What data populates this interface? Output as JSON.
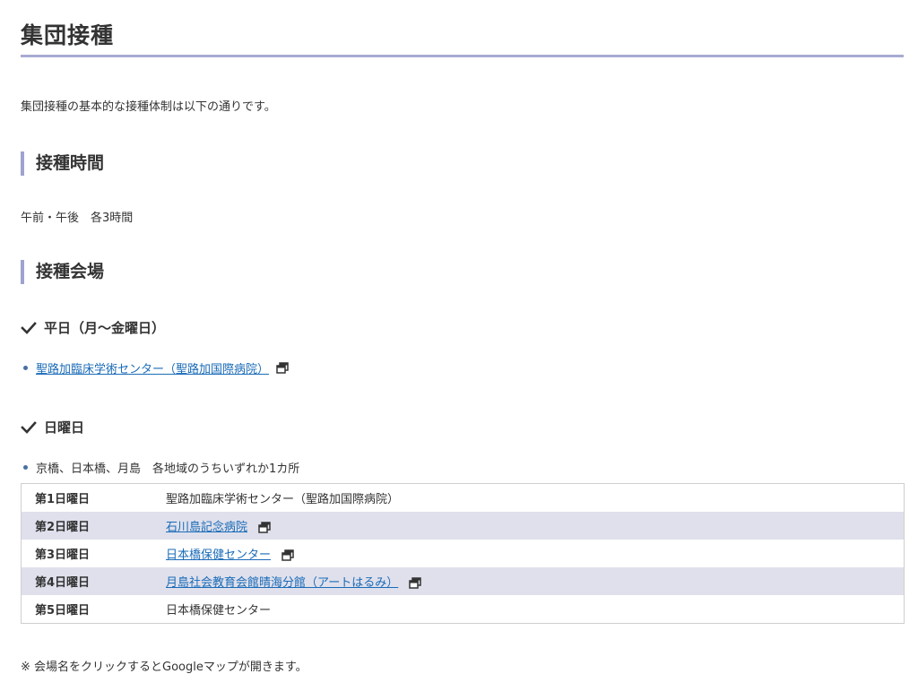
{
  "title": "集団接種",
  "intro": "集団接種の基本的な接種体制は以下の通りです。",
  "time_section": {
    "heading": "接種時間",
    "text": "午前・午後　各3時間"
  },
  "venue_section": {
    "heading": "接種会場",
    "weekday": {
      "heading": "平日（月～金曜日）",
      "items": [
        "聖路加臨床学術センター（聖路加国際病院）"
      ]
    },
    "sunday": {
      "heading": "日曜日",
      "items": [
        "京橋、日本橋、月島　各地域のうちいずれか1カ所"
      ],
      "schedule": [
        {
          "day": "第1日曜日",
          "venue": "聖路加臨床学術センター（聖路加国際病院）"
        },
        {
          "day": "第2日曜日",
          "venue": "石川島記念病院"
        },
        {
          "day": "第3日曜日",
          "venue": "日本橋保健センター"
        },
        {
          "day": "第4日曜日",
          "venue": "月島社会教育会館晴海分館（アートはるみ）"
        },
        {
          "day": "第5日曜日",
          "venue": "日本橋保健センター"
        }
      ]
    }
  },
  "note": "※ 会場名をクリックするとGoogleマップが開きます。",
  "colors": {
    "accent": "#a8abd2",
    "link": "#1a6bb7",
    "row_alt": "#dfe0ec"
  },
  "icons": [
    "checkmark-icon",
    "external-window-icon"
  ]
}
